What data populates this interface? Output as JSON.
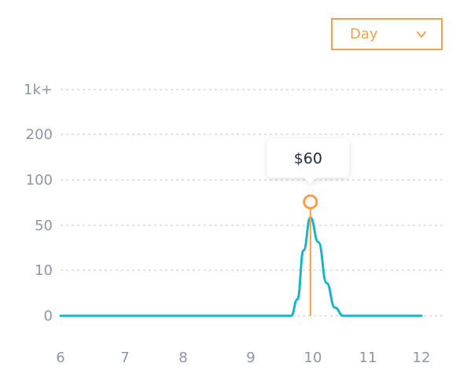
{
  "controls": {
    "range_select": {
      "value": "Day"
    }
  },
  "colors": {
    "line": "#1ab3c7",
    "accent": "#f4a04a",
    "grid": "#d6d9de",
    "axis_text": "#8e95a3"
  },
  "chart_data": {
    "type": "line",
    "x_ticks": [
      "6",
      "7",
      "8",
      "9",
      "10",
      "11",
      "12"
    ],
    "y_ticks": [
      "0",
      "10",
      "50",
      "100",
      "200",
      "1k+"
    ],
    "xlim": [
      6,
      12
    ],
    "grid": true,
    "series": [
      {
        "x": [
          6,
          7,
          8,
          9,
          9.65,
          9.75,
          9.85,
          9.96,
          10.1,
          10.25,
          10.4,
          10.55,
          12
        ],
        "y": [
          0,
          0,
          0,
          0,
          0,
          10,
          40,
          60,
          45,
          20,
          5,
          0,
          0
        ]
      }
    ],
    "highlight": {
      "x": 9.96,
      "label": "$60"
    }
  }
}
